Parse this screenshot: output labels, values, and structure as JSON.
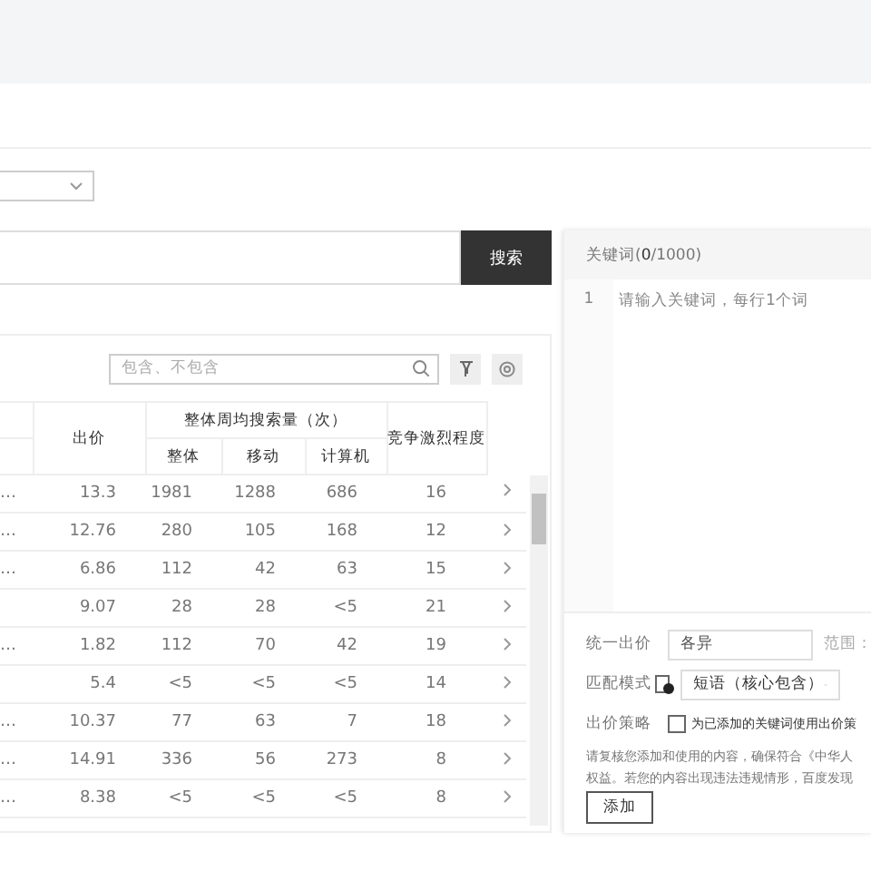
{
  "search": {
    "button": "搜索"
  },
  "table": {
    "filter": {
      "placeholder": "包含、不包含"
    },
    "columns": {
      "bid": "出价",
      "volume_group": "整体周均搜索量（次）",
      "overall": "整体",
      "mobile": "移动",
      "pc": "计算机",
      "competition": "竞争激烈程度"
    },
    "rows": [
      {
        "keyword": "…",
        "bid": "13.3",
        "overall": "1981",
        "mobile": "1288",
        "pc": "686",
        "competition": "16"
      },
      {
        "keyword": "…",
        "bid": "12.76",
        "overall": "280",
        "mobile": "105",
        "pc": "168",
        "competition": "12"
      },
      {
        "keyword": "…",
        "bid": "6.86",
        "overall": "112",
        "mobile": "42",
        "pc": "63",
        "competition": "15"
      },
      {
        "bid": "9.07",
        "overall": "28",
        "mobile": "28",
        "pc": "<5",
        "competition": "21"
      },
      {
        "keyword": "…",
        "bid": "1.82",
        "overall": "112",
        "mobile": "70",
        "pc": "42",
        "competition": "19"
      },
      {
        "bid": "5.4",
        "overall": "<5",
        "mobile": "<5",
        "pc": "<5",
        "competition": "14"
      },
      {
        "keyword": "…",
        "bid": "10.37",
        "overall": "77",
        "mobile": "63",
        "pc": "7",
        "competition": "18"
      },
      {
        "keyword": "…",
        "bid": "14.91",
        "overall": "336",
        "mobile": "56",
        "pc": "273",
        "competition": "8"
      },
      {
        "keyword": "…",
        "bid": "8.38",
        "overall": "<5",
        "mobile": "<5",
        "pc": "<5",
        "competition": "8"
      }
    ]
  },
  "keyword_panel": {
    "title": "关键词(",
    "count": "0",
    "total": "/1000)",
    "line_number": "1",
    "placeholder": "请输入关键词，每行1个词"
  },
  "form": {
    "bid_label": "统一出价",
    "bid_value": "各异",
    "range_label": "范围：",
    "match_label": "匹配模式",
    "match_value": "短语（核心包含）",
    "strategy_label": "出价策略",
    "strategy_checked": false,
    "strategy_text": "为已添加的关键词使用出价策",
    "notice": [
      "请复核您添加和使用的内容，确保符合《中华人",
      "权益。若您的内容出现违法违规情形，百度发现"
    ],
    "add_button": "添加"
  }
}
